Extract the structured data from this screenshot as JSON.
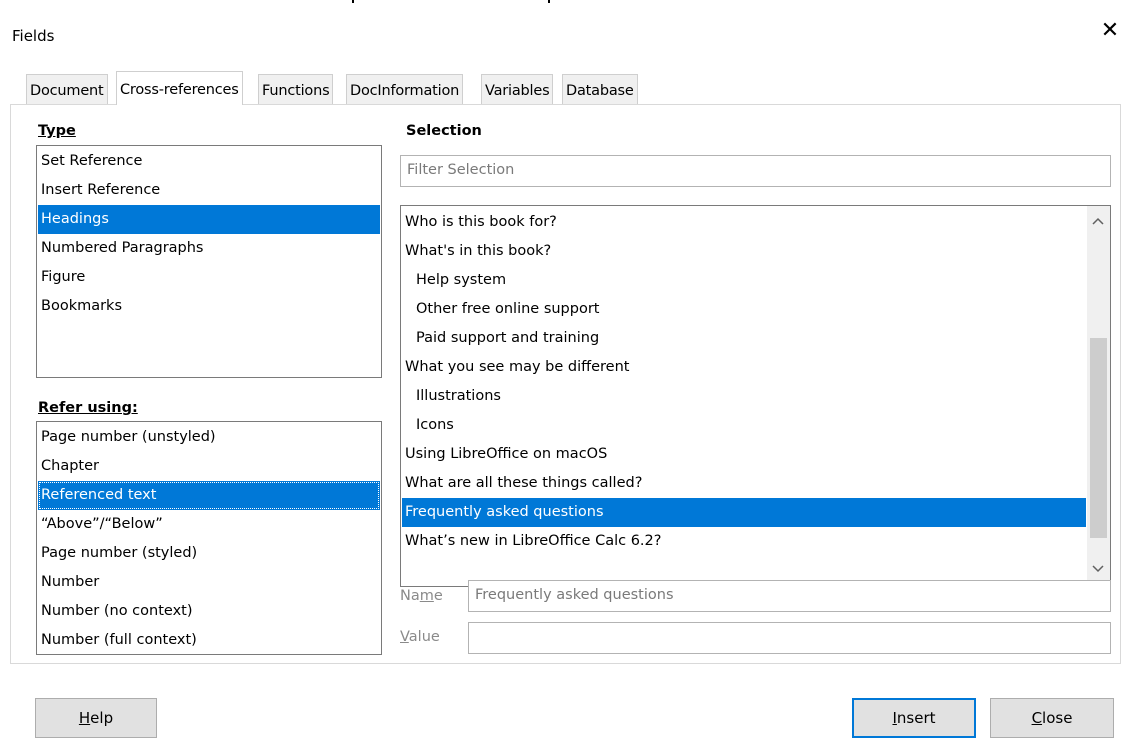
{
  "window": {
    "title": "Fields",
    "close_glyph": "✕"
  },
  "tabs": [
    {
      "label": "Document"
    },
    {
      "label": "Cross-references"
    },
    {
      "label": "Functions"
    },
    {
      "label": "DocInformation"
    },
    {
      "label": "Variables"
    },
    {
      "label": "Database"
    }
  ],
  "type_panel": {
    "label": "Type",
    "items": [
      "Set Reference",
      "Insert Reference",
      "Headings",
      "Numbered Paragraphs",
      "Figure",
      "Bookmarks"
    ],
    "selected": "Headings"
  },
  "refer_panel": {
    "label": "Refer using:",
    "items": [
      "Page number (unstyled)",
      "Chapter",
      "Referenced text",
      "“Above”/“Below”",
      "Page number (styled)",
      "Number",
      "Number (no context)",
      "Number (full context)"
    ],
    "selected": "Referenced text"
  },
  "selection_panel": {
    "label": "Selection",
    "filter_placeholder": "Filter Selection",
    "items": [
      "Who is this book for?",
      "What's in this book?",
      "Help system",
      "Other free online support",
      "Paid support and training",
      "What you see may be different",
      "Illustrations",
      "Icons",
      "Using LibreOffice on macOS",
      "What are all these things called?",
      "Frequently asked questions",
      "What’s new in LibreOffice Calc 6.2?"
    ],
    "selected": "Frequently asked questions",
    "scrollbar": {
      "up_icon": "chevron-up",
      "down_icon": "chevron-down"
    }
  },
  "name_field": {
    "label_pre": "Na",
    "label_u": "m",
    "label_post": "e",
    "value": "Frequently asked questions"
  },
  "value_field": {
    "label_u": "V",
    "label_post": "alue",
    "value": ""
  },
  "buttons": {
    "help": {
      "u": "H",
      "rest": "elp"
    },
    "insert": {
      "u": "I",
      "rest": "nsert"
    },
    "close": {
      "u": "C",
      "rest": "lose"
    }
  }
}
